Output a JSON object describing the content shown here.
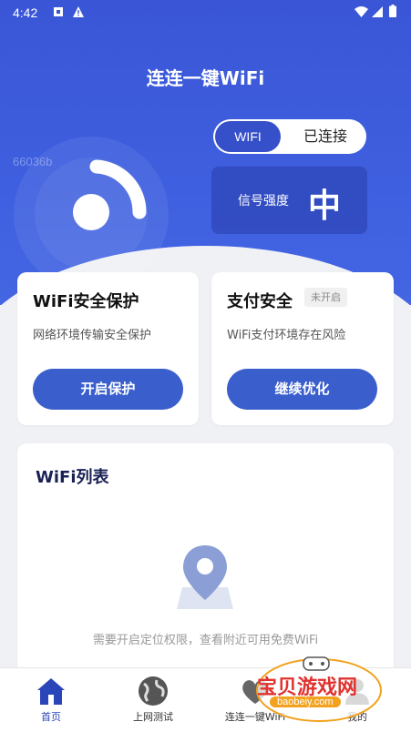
{
  "status": {
    "time": "4:42"
  },
  "header": {
    "title": "连连一键WiFi",
    "device_id": "66036b"
  },
  "connection": {
    "toggle_wifi": "WIFI",
    "toggle_status": "已连接"
  },
  "signal": {
    "label": "信号强度",
    "value": "中"
  },
  "cards": [
    {
      "title": "WiFi安全保护",
      "desc": "网络环境传输安全保护",
      "button": "开启保护"
    },
    {
      "title": "支付安全",
      "badge": "未开启",
      "desc": "WiFi支付环境存在风险",
      "button": "继续优化"
    }
  ],
  "wifi_list": {
    "title": "WiFi列表",
    "hint": "需要开启定位权限，查看附近可用免费WiFi"
  },
  "tabs": [
    {
      "label": "首页",
      "icon": "home-icon",
      "active": true
    },
    {
      "label": "上网测试",
      "icon": "globe-icon",
      "active": false
    },
    {
      "label": "连连一键WiFi",
      "icon": "heart-icon",
      "active": false
    },
    {
      "label": "我的",
      "icon": "user-icon",
      "active": false
    }
  ],
  "watermark": {
    "text": "宝贝游戏网",
    "url": "baobeiy.com"
  },
  "colors": {
    "primary": "#3a5fcd",
    "hero": "#3e5fdf",
    "background": "#f0f1f5"
  }
}
